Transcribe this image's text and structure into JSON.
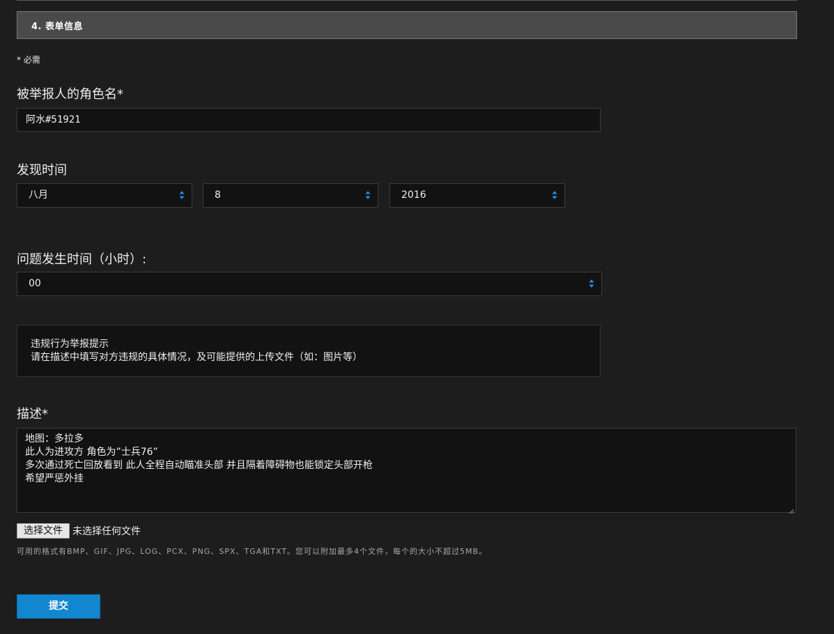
{
  "section": {
    "title": "4. 表单信息"
  },
  "required_note": "*  必需",
  "character": {
    "label": "被举报人的角色名*",
    "value": "阿水#51921"
  },
  "found_time": {
    "label": "发现时间",
    "month": "八月",
    "day": "8",
    "year": "2016"
  },
  "hour": {
    "label": "问题发生时间（小时）:",
    "value": "00"
  },
  "hint": {
    "line1": "违规行为举报提示",
    "line2": "请在描述中填写对方违规的具体情况，及可能提供的上传文件（如：图片等）"
  },
  "description": {
    "label": "描述*",
    "lines": [
      "地图：多拉多",
      "此人为进攻方 角色为”士兵76”",
      "多次通过死亡回放看到 此人全程自动瞄准头部 并且隔着障碍物也能锁定头部开枪",
      "希望严惩外挂"
    ]
  },
  "upload": {
    "button_label": "选择文件",
    "status": "未选择任何文件",
    "help": "可用的格式有BMP、GIF、JPG、LOG、PCX、PNG、SPX、TGA和TXT。您可以附加最多4个文件，每个的大小不超过5MB。"
  },
  "submit": {
    "label": "提交"
  },
  "colors": {
    "accent": "#1286cf",
    "background": "#1d1d1d",
    "field_background": "#121212",
    "header_background": "#4a4a4a"
  }
}
